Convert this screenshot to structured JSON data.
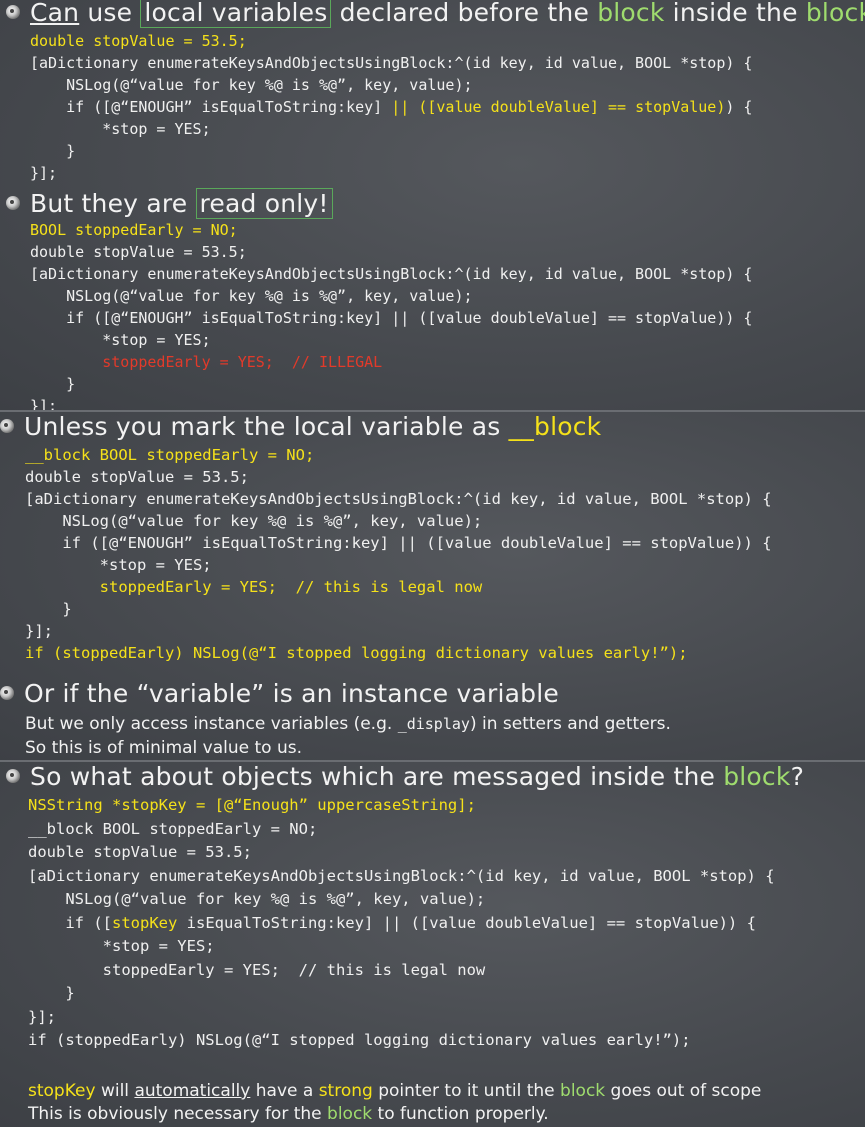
{
  "s1": {
    "p1": "Can",
    "p2": " use ",
    "p3": "local variables",
    "p4": " declared before the ",
    "p5": "block",
    "p6": " inside the ",
    "p7": "block",
    "l1": "double stopValue = 53.5;",
    "l2": "[aDictionary enumerateKeysAndObjectsUsingBlock:^(id key, id value, BOOL *stop) {",
    "l3": "    NSLog(@“value for key %@ is %@”, key, value);",
    "l4a": "    if ([@“ENOUGH” isEqualToString:key] ",
    "l4b": "|| ([value doubleValue] == stopValue)",
    "l4c": ") {",
    "l5": "        *stop = YES;",
    "l6": "    }",
    "l7": "}];"
  },
  "s2": {
    "p1": "But they are ",
    "p2": "read only!",
    "l1": "BOOL stoppedEarly = NO;",
    "l2": "double stopValue = 53.5;",
    "l3": "[aDictionary enumerateKeysAndObjectsUsingBlock:^(id key, id value, BOOL *stop) {",
    "l4": "    NSLog(@“value for key %@ is %@”, key, value);",
    "l5": "    if ([@“ENOUGH” isEqualToString:key] || ([value doubleValue] == stopValue)) {",
    "l6": "        *stop = YES;",
    "l7": "        stoppedEarly = YES;  // ILLEGAL",
    "l8": "    }",
    "l9": "}];"
  },
  "s3": {
    "p1": "Unless you mark the local variable as ",
    "p2": "__block",
    "l1": "__block BOOL stoppedEarly = NO;",
    "l2": "double stopValue = 53.5;",
    "l3": "[aDictionary enumerateKeysAndObjectsUsingBlock:^(id key, id value, BOOL *stop) {",
    "l4": "    NSLog(@“value for key %@ is %@”, key, value);",
    "l5": "    if ([@“ENOUGH” isEqualToString:key] || ([value doubleValue] == stopValue)) {",
    "l6": "        *stop = YES;",
    "l7": "        stoppedEarly = YES;  // this is legal now",
    "l8": "    }",
    "l9": "}];",
    "l10": "if (stoppedEarly) NSLog(@“I stopped logging dictionary values early!”);"
  },
  "s4": {
    "title": "Or if the “variable” is an instance variable",
    "t1a": "But we only access instance variables (e.g. ",
    "t1b": "_display",
    "t1c": ") in setters and getters.",
    "t2": "So this is of minimal value to us."
  },
  "s5": {
    "p1": "So what about objects which are messaged inside the ",
    "p2": "block",
    "p3": "?",
    "l1": "NSString *stopKey = [@“Enough” uppercaseString];",
    "l2": "__block BOOL stoppedEarly = NO;",
    "l3": "double stopValue = 53.5;",
    "l4": "[aDictionary enumerateKeysAndObjectsUsingBlock:^(id key, id value, BOOL *stop) {",
    "l5": "    NSLog(@“value for key %@ is %@”, key, value);",
    "l6a": "    if ([",
    "l6b": "stopKey",
    "l6c": " isEqualToString:key] || ([value doubleValue] == stopValue)) {",
    "l7": "        *stop = YES;",
    "l8": "        stoppedEarly = YES;  // this is legal now",
    "l9": "    }",
    "l10": "}];",
    "l11": "if (stoppedEarly) NSLog(@“I stopped logging dictionary values early!”);",
    "n1a": "stopKey",
    "n1b": " will ",
    "n1c": "automatically",
    "n1d": " have a ",
    "n1e": "strong",
    "n1f": " pointer to it until the ",
    "n1g": "block",
    "n1h": " goes out of scope",
    "n2a": "This is obviously necessary for the ",
    "n2b": "block",
    "n2c": " to function properly."
  }
}
